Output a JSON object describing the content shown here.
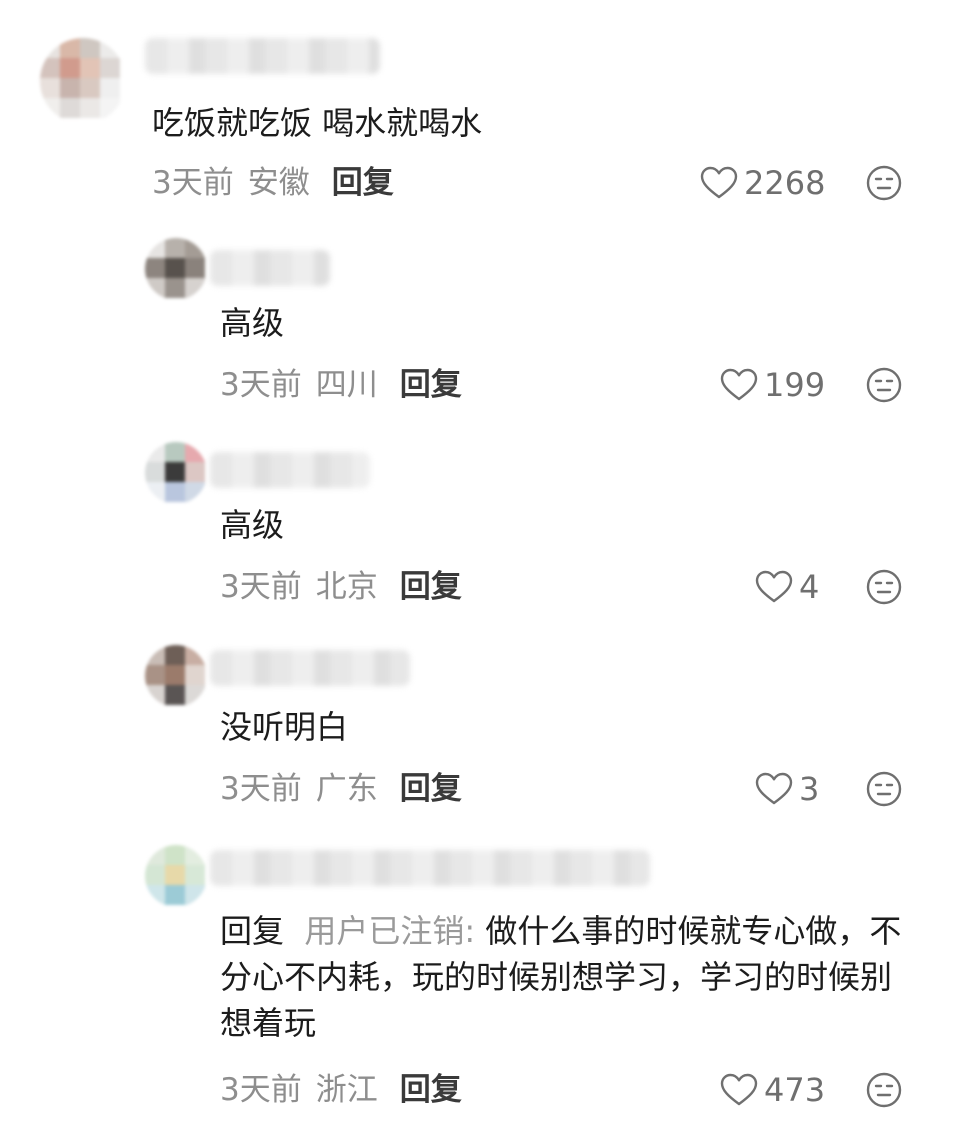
{
  "comments": [
    {
      "text": "吃饭就吃饭 喝水就喝水",
      "time": "3天前",
      "location": "安徽",
      "reply_label": "回复",
      "likes": "2268"
    },
    {
      "text": "高级",
      "time": "3天前",
      "location": "四川",
      "reply_label": "回复",
      "likes": "199"
    },
    {
      "text": "高级",
      "time": "3天前",
      "location": "北京",
      "reply_label": "回复",
      "likes": "4"
    },
    {
      "text": "没听明白",
      "time": "3天前",
      "location": "广东",
      "reply_label": "回复",
      "likes": "3"
    },
    {
      "reply_prefix": "回复",
      "reply_target": "用户已注销:",
      "text": "做什么事的时候就专心做，不分心不内耗，玩的时候别想学习，学习的时候别想着玩",
      "time": "3天前",
      "location": "浙江",
      "reply_label": "回复",
      "likes": "473"
    }
  ],
  "icons": {
    "like": "heart-outline-icon",
    "reaction": "neutral-face-icon"
  },
  "colors": {
    "meta": "#8e8e8e",
    "text": "#1c1c1c",
    "icon": "#6f6f6f"
  }
}
